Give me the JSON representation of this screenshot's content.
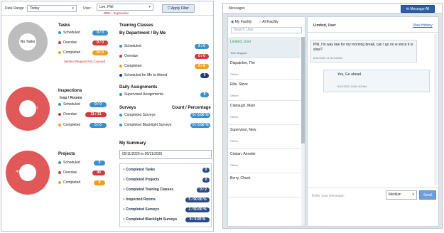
{
  "filters": {
    "date_range_label": "Date Range :",
    "date_range_value": "Today",
    "user_label": "User :",
    "user_value": "Lee, Phil",
    "user_role": "RED - Supervisor",
    "apply_label": "Apply Filter"
  },
  "tasks": {
    "title": "Tasks",
    "ring_label": "No Tasks",
    "rows": [
      {
        "label": "Scheduled",
        "value": "0 / 0"
      },
      {
        "label": "Overdue",
        "value": "0 / 0"
      },
      {
        "label": "Completed",
        "value": "0 / 0"
      }
    ],
    "note": "Service Request Not Covered"
  },
  "inspections": {
    "title": "Inspections",
    "subtitle": "Insp / Rooms",
    "ring_label": "11",
    "rows": [
      {
        "label": "Scheduled",
        "value": "0 / 0"
      },
      {
        "label": "Overdue",
        "value": "11 / 21"
      },
      {
        "label": "Completed",
        "value": "0 / 0"
      }
    ]
  },
  "projects": {
    "title": "Projects",
    "ring_label": "40",
    "rows": [
      {
        "label": "Scheduled",
        "value": "0"
      },
      {
        "label": "Overdue",
        "value": "40"
      },
      {
        "label": "Completed",
        "value": "0"
      }
    ]
  },
  "training": {
    "title": "Training Classes",
    "subtitle": "By Department / By Me",
    "rows": [
      {
        "label": "Scheduled",
        "value": "0 / 0"
      },
      {
        "label": "Overdue",
        "value": "0 / 0"
      },
      {
        "label": "Completed",
        "value": "0 / 0"
      },
      {
        "label": "Scheduled for Me to Attend",
        "value": "0"
      }
    ]
  },
  "daily": {
    "title": "Daily Assignments",
    "rows": [
      {
        "label": "Supervised Assignments",
        "value": "9"
      }
    ]
  },
  "surveys": {
    "title": "Surveys",
    "count_header": "Count / Percentage",
    "rows": [
      {
        "label": "Completed Surveys",
        "value": "0 / 0.00 %"
      },
      {
        "label": "Completed Blacklight Surveys",
        "value": "0 / 0.00 %"
      }
    ]
  },
  "summary": {
    "title": "My Summary",
    "range": "05/11/2020 to 06/11/2020",
    "rows": [
      {
        "label": "Completed Tasks",
        "value": "0"
      },
      {
        "label": "Completed Projects",
        "value": "0"
      },
      {
        "label": "Completed Training Classes",
        "value": "0 / 2"
      },
      {
        "label": "Inspected Rooms",
        "value": "5 / 90.00 %"
      },
      {
        "label": "Completed Surveys",
        "value": "1 / 50.00 %"
      },
      {
        "label": "Completed Blacklight Surveys",
        "value": "0 / 0.00 %"
      }
    ]
  },
  "messages": {
    "title": "Messages",
    "message_all": "Message All",
    "radio_my": "My Facility",
    "radio_all": "All Facility",
    "search_placeholder": "Search User",
    "chat_with": "Limited, User",
    "view_history": "View History",
    "users": [
      {
        "name": "Limited, User",
        "sub": "Tech Support"
      },
      {
        "name": "Dispatcher, The",
        "sub": "Offline"
      },
      {
        "name": "Ellis, Steve",
        "sub": "Offline"
      },
      {
        "name": "Clabaugh, Mark",
        "sub": "Offline"
      },
      {
        "name": "Supervisor, New",
        "sub": "Offline"
      },
      {
        "name": "Cristan, Annette",
        "sub": "Offline"
      },
      {
        "name": "Berry, Chuck",
        "sub": ""
      }
    ],
    "bubbles": [
      {
        "text": "Phil, I'm way late for my morning break, can I go no w since it is slow?",
        "time": "6/11/2020 11:51:08 AM"
      },
      {
        "text": "Yes, Go ahead.",
        "time": "6/11/2020 10:51:53 AM"
      }
    ],
    "input_placeholder": "Enter your message.",
    "priority": "Medium",
    "send": "Send"
  },
  "colors": {
    "blue": "#3a8fd0",
    "red": "#d03a3a",
    "gray_ring": "#bdbdbd",
    "red_ring": "#e05858",
    "green_active": "#2fa84f",
    "orange": "#f0a020"
  }
}
